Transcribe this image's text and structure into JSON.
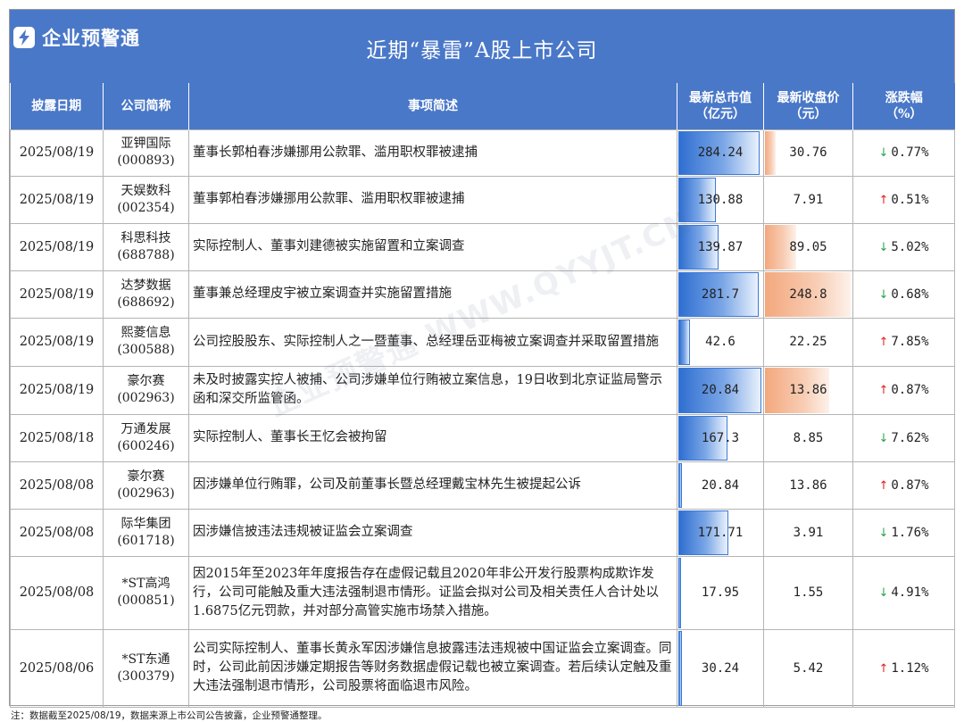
{
  "header": {
    "brand": "企业预警通",
    "title": "近期“暴雷”A股上市公司"
  },
  "columns": [
    {
      "label": "披露日期"
    },
    {
      "label": "公司简称"
    },
    {
      "label": "事项简述"
    },
    {
      "label": "最新总市值\n（亿元）"
    },
    {
      "label": "最新收盘价\n（元）"
    },
    {
      "label": "涨跌幅\n（%）"
    }
  ],
  "rows": [
    {
      "date": "2025/08/19",
      "name": "亚钾国际",
      "code": "(000893)",
      "desc": "董事长郭柏春涉嫌挪用公款罪、滥用职权罪被逮捕",
      "mcap": "284.24",
      "mcap_frac": 0.96,
      "price": "30.76",
      "price_frac": 0.12,
      "dir": "down",
      "arrow": "↓",
      "chg": "0.77%"
    },
    {
      "date": "2025/08/19",
      "name": "天娱数科",
      "code": "(002354)",
      "desc": "董事郭柏春涉嫌挪用公款罪、滥用职权罪被逮捕",
      "mcap": "130.88",
      "mcap_frac": 0.44,
      "price": "7.91",
      "price_frac": 0.0,
      "dir": "up",
      "arrow": "↑",
      "chg": "0.51%"
    },
    {
      "date": "2025/08/19",
      "name": "科思科技",
      "code": "(688788)",
      "desc": "实际控制人、董事刘建德被实施留置和立案调查",
      "mcap": "139.87",
      "mcap_frac": 0.47,
      "price": "89.05",
      "price_frac": 0.36,
      "dir": "down",
      "arrow": "↓",
      "chg": "5.02%"
    },
    {
      "date": "2025/08/19",
      "name": "达梦数据",
      "code": "(688692)",
      "desc": "董事兼总经理皮宇被立案调查并实施留置措施",
      "mcap": "281.7",
      "mcap_frac": 0.95,
      "price": "248.8",
      "price_frac": 1.0,
      "dir": "down",
      "arrow": "↓",
      "chg": "0.68%"
    },
    {
      "date": "2025/08/19",
      "name": "熙菱信息",
      "code": "(300588)",
      "desc": "公司控股股东、实际控制人之一暨董事、总经理岳亚梅被立案调查并采取留置措施",
      "mcap": "42.6",
      "mcap_frac": 0.14,
      "price": "22.25",
      "price_frac": 0.0,
      "dir": "up",
      "arrow": "↑",
      "chg": "7.85%"
    },
    {
      "date": "2025/08/19",
      "name": "豪尔赛",
      "code": "(002963)",
      "desc": "未及时披露实控人被捕、公司涉嫌单位行贿被立案信息，19日收到北京证监局警示函和深交所监管函。",
      "mcap": "20.84",
      "mcap_frac": 0.98,
      "price": "13.86",
      "price_frac": 0.75,
      "dir": "up",
      "arrow": "↑",
      "chg": "0.87%"
    },
    {
      "date": "2025/08/18",
      "name": "万通发展",
      "code": "(600246)",
      "desc": "实际控制人、董事长王忆会被拘留",
      "mcap": "167.3",
      "mcap_frac": 0.58,
      "price": "8.85",
      "price_frac": 0.0,
      "dir": "down",
      "arrow": "↓",
      "chg": "7.62%"
    },
    {
      "date": "2025/08/08",
      "name": "豪尔赛",
      "code": "(002963)",
      "desc": "因涉嫌单位行贿罪，公司及前董事长暨总经理戴宝林先生被提起公诉",
      "mcap": "20.84",
      "mcap_frac": 0.04,
      "price": "13.86",
      "price_frac": 0.0,
      "dir": "up",
      "arrow": "↑",
      "chg": "0.87%"
    },
    {
      "date": "2025/08/08",
      "name": "际华集团",
      "code": "(601718)",
      "desc": "因涉嫌信披违法违规被证监会立案调查",
      "mcap": "171.71",
      "mcap_frac": 0.59,
      "price": "3.91",
      "price_frac": 0.0,
      "dir": "down",
      "arrow": "↓",
      "chg": "1.76%"
    },
    {
      "date": "2025/08/08",
      "name": "*ST高鸿",
      "code": "(000851)",
      "desc": "因2015年至2023年年度报告存在虚假记载且2020年非公开发行股票构成欺诈发行，公司可能触及重大违法强制退市情形。证监会拟对公司及相关责任人合计处以1.6875亿元罚款，并对部分高管实施市场禁入措施。",
      "mcap": "17.95",
      "mcap_frac": 0.03,
      "price": "1.55",
      "price_frac": 0.0,
      "dir": "down",
      "arrow": "↓",
      "chg": "4.91%"
    },
    {
      "date": "2025/08/06",
      "name": "*ST东通",
      "code": "(300379)",
      "desc": "公司实际控制人、董事长黄永军因涉嫌信息披露违法违规被中国证监会立案调查。同时，公司此前因涉嫌定期报告等财务数据虚假记载也被立案调查。若后续认定触及重大违法强制退市情形，公司股票将面临退市风险。",
      "mcap": "30.24",
      "mcap_frac": 0.04,
      "price": "5.42",
      "price_frac": 0.0,
      "dir": "up",
      "arrow": "↑",
      "chg": "1.12%"
    }
  ],
  "watermark": "企业预警通 WWW.QYYJT.CN",
  "footnote": "注：数据截至2025/08/19，数据来源上市公司公告披露，企业预警通整理。"
}
